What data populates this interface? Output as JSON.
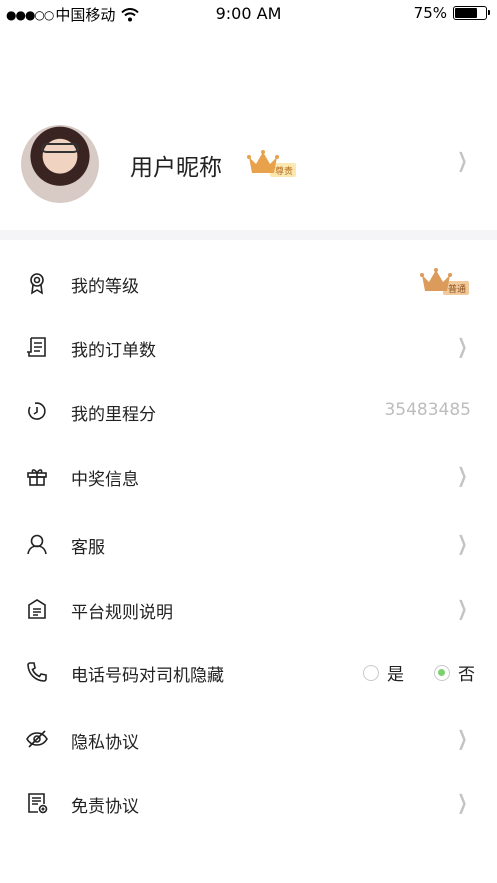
{
  "status_bar": {
    "signal": "●●●○○",
    "carrier": "中国移动",
    "time": "9:00 AM",
    "battery_percent": "75%",
    "battery_level": 0.75
  },
  "profile": {
    "nickname": "用户昵称",
    "vip_badge": "尊贵"
  },
  "menu": {
    "items": [
      {
        "label": "我的等级",
        "icon": "medal-icon",
        "badge": "普通"
      },
      {
        "label": "我的订单数",
        "icon": "receipt-icon"
      },
      {
        "label": "我的里程分",
        "icon": "timer-icon",
        "value": "35483485"
      },
      {
        "label": "中奖信息",
        "icon": "gift-icon"
      },
      {
        "label": "客服",
        "icon": "user-icon"
      },
      {
        "label": "平台规则说明",
        "icon": "document-icon"
      },
      {
        "label": "电话号码对司机隐藏",
        "icon": "phone-icon",
        "options": [
          "是",
          "否"
        ],
        "selected": "否"
      },
      {
        "label": "隐私协议",
        "icon": "eye-off-icon"
      },
      {
        "label": "免责协议",
        "icon": "clipboard-icon"
      }
    ]
  },
  "colors": {
    "accent_green": "#7bd16b",
    "crown_gold": "#e8a24b",
    "divider": "#f5f5f7",
    "muted_text": "#bdbdbd"
  }
}
